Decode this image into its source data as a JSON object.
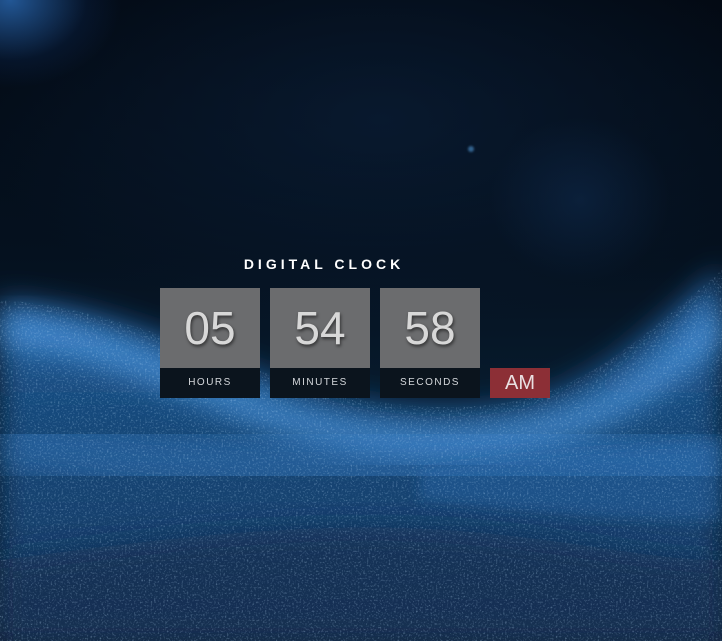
{
  "clock": {
    "title": "DIGITAL CLOCK",
    "hours": "05",
    "minutes": "54",
    "seconds": "58",
    "hours_label": "HOURS",
    "minutes_label": "MINUTES",
    "seconds_label": "SECONDS",
    "meridiem": "AM"
  },
  "colors": {
    "digit_box": "#6b6c6e",
    "label_box": "#0b141d",
    "meridiem_box": "#8c2f36",
    "background": "#020913"
  }
}
